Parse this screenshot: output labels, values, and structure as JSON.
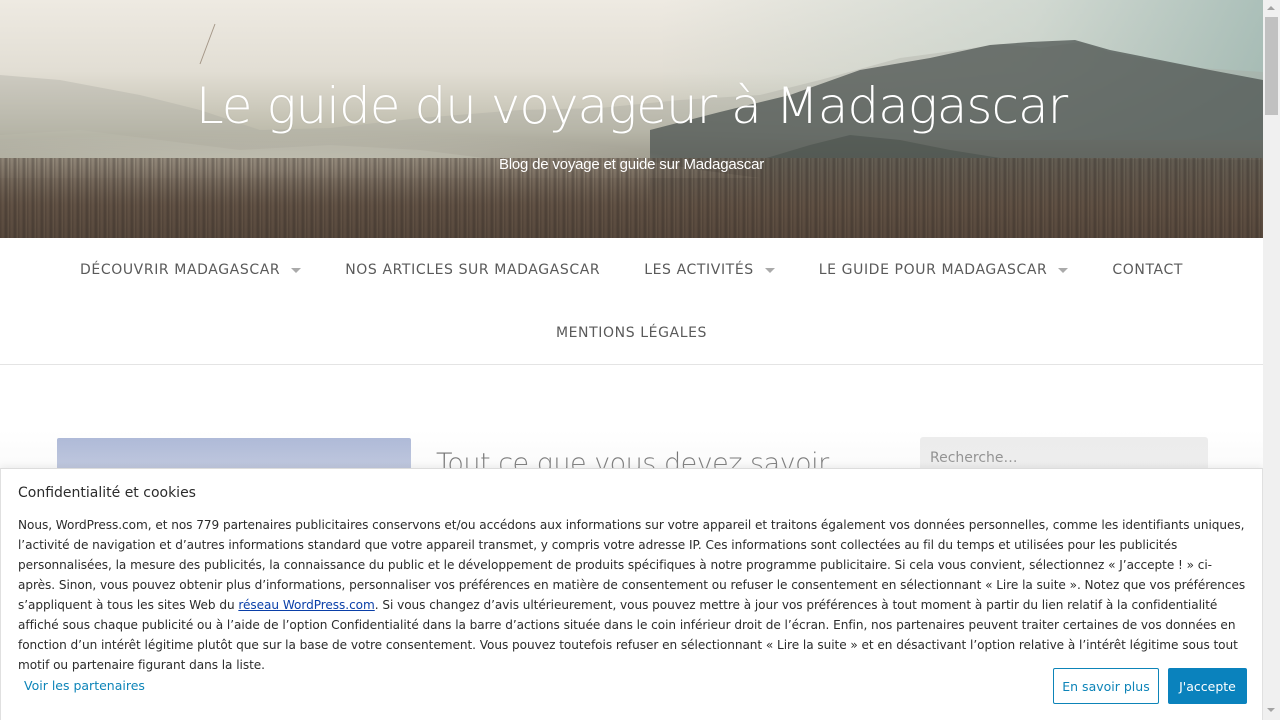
{
  "header": {
    "site_title": "Le guide du voyageur à Madagascar",
    "tagline": "Blog de voyage et guide sur Madagascar"
  },
  "nav": {
    "items": [
      {
        "label": "Découvrir Madagascar",
        "has_dropdown": true
      },
      {
        "label": "Nos articles sur Madagascar",
        "has_dropdown": false
      },
      {
        "label": "Les activités",
        "has_dropdown": true
      },
      {
        "label": "Le guide pour Madagascar",
        "has_dropdown": true
      },
      {
        "label": "Contact",
        "has_dropdown": false
      },
      {
        "label": "Mentions légales",
        "has_dropdown": false
      }
    ]
  },
  "main": {
    "article_title": "Tout ce que vous devez savoir"
  },
  "sidebar": {
    "search_placeholder": "Recherche…"
  },
  "cookie_banner": {
    "title": "Confidentialité et cookies",
    "body_part1": "Nous, WordPress.com, et nos 779 partenaires publicitaires conservons et/ou accédons aux informations sur votre appareil et traitons également vos données personnelles, comme les identifiants uniques, l’activité de navigation et d’autres informations standard que votre appareil transmet, y compris votre adresse IP. Ces informations sont collectées au fil du temps et utilisées pour les publicités personnalisées, la mesure des publicités, la connaissance du public et le développement de produits spécifiques à notre programme publicitaire. Si cela vous convient, sélectionnez « J’accepte ! » ci-après. Sinon, vous pouvez obtenir plus d’informations, personnaliser vos préférences en matière de consentement ou refuser le consentement en sélectionnant « Lire la suite ». Notez que vos préférences s’appliquent à tous les sites Web du ",
    "body_link": "réseau WordPress.com",
    "body_part2": ". Si vous changez d’avis ultérieurement, vous pouvez mettre à jour vos préférences à tout moment à partir du lien relatif à la confidentialité affiché sous chaque publicité ou à l’aide de l’option Confidentialité dans la barre d’actions située dans le coin inférieur droit de l’écran. Enfin, nos partenaires peuvent traiter certaines de vos données en fonction d’un intérêt légitime plutôt que sur la base de votre consentement. Vous pouvez toutefois refuser en sélectionnant « Lire la suite » et en désactivant l’option relative à l’intérêt légitime sous tout motif ou partenaire figurant dans la liste.",
    "partners_link": "Voir les partenaires",
    "learn_more_button": "En savoir plus",
    "accept_button": "J'accepte",
    "accent_color": "#0a82bd"
  },
  "icons": {
    "nav_dropdown": "caret-down-icon",
    "scroll_up": "scroll-up-arrow-icon",
    "scroll_down": "scroll-down-arrow-icon"
  }
}
